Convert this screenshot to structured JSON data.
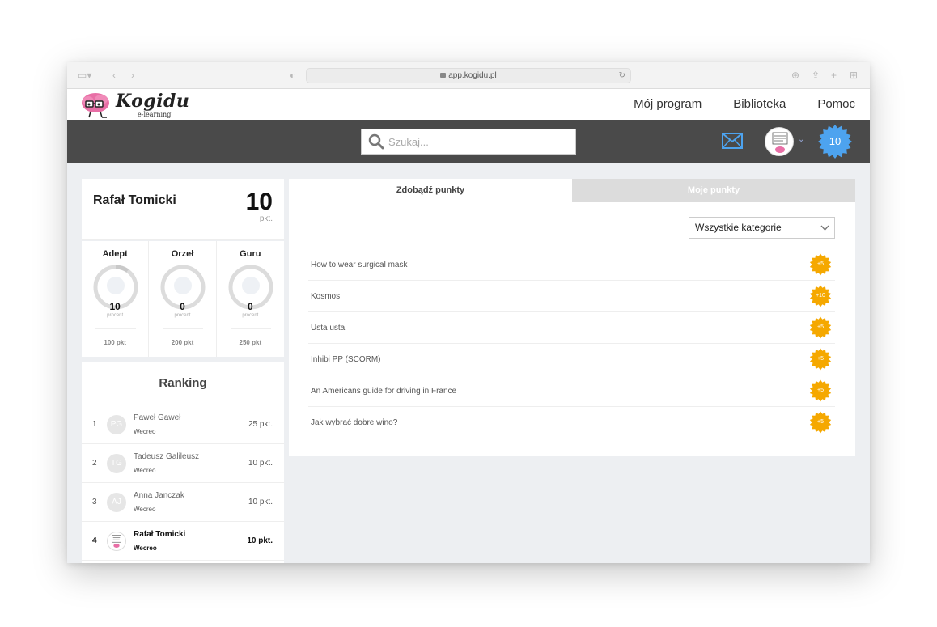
{
  "browser": {
    "url": "app.kogidu.pl"
  },
  "header": {
    "logo_text": "Kogidu",
    "logo_sub": "e-learning",
    "nav": [
      "Mój program",
      "Biblioteka",
      "Pomoc"
    ]
  },
  "toolbar": {
    "search_placeholder": "Szukaj...",
    "points": "10",
    "accent": "#4da3ef"
  },
  "profile": {
    "name": "Rafał Tomicki",
    "points": "10",
    "points_unit": "pkt."
  },
  "levels": [
    {
      "name": "Adept",
      "value": "10",
      "percent": 10,
      "sub": "procent",
      "threshold": "100 pkt"
    },
    {
      "name": "Orzeł",
      "value": "0",
      "percent": 0,
      "sub": "procent",
      "threshold": "200 pkt"
    },
    {
      "name": "Guru",
      "value": "0",
      "percent": 0,
      "sub": "procent",
      "threshold": "250 pkt"
    }
  ],
  "ranking": {
    "title": "Ranking",
    "rows": [
      {
        "rank": "1",
        "initials": "PG",
        "name": "Paweł Gaweł",
        "org": "Wecreo",
        "points": "25 pkt."
      },
      {
        "rank": "2",
        "initials": "TG",
        "name": "Tadeusz Galileusz",
        "org": "Wecreo",
        "points": "10 pkt."
      },
      {
        "rank": "3",
        "initials": "AJ",
        "name": "Anna Janczak",
        "org": "Wecreo",
        "points": "10 pkt."
      },
      {
        "rank": "4",
        "initials": "",
        "name": "Rafał Tomicki",
        "org": "Wecreo",
        "points": "10 pkt.",
        "current": true
      }
    ]
  },
  "tabs": {
    "earn": "Zdobądź punkty",
    "mine": "Moje punkty"
  },
  "filter": {
    "selected": "Wszystkie kategorie"
  },
  "items": [
    {
      "title": "How to wear surgical mask",
      "reward": "+5"
    },
    {
      "title": "Kosmos",
      "reward": "+10"
    },
    {
      "title": "Usta usta",
      "reward": "+5"
    },
    {
      "title": "Inhibi PP (SCORM)",
      "reward": "+5"
    },
    {
      "title": "An Americans guide for driving in France",
      "reward": "+5"
    },
    {
      "title": "Jak wybrać dobre wino?",
      "reward": "+5"
    }
  ],
  "colors": {
    "badge": "#f5a800",
    "dark_bar": "#4a4a4a"
  }
}
